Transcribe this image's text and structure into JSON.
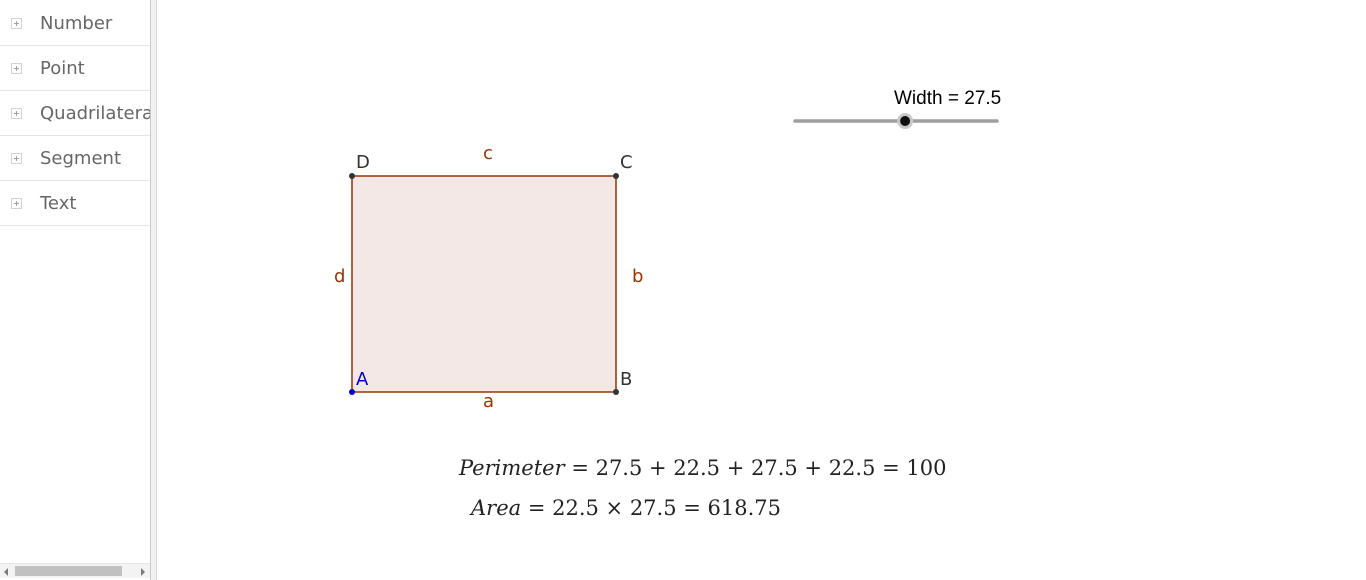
{
  "algebra": {
    "categories": [
      {
        "label": "Number"
      },
      {
        "label": "Point"
      },
      {
        "label": "Quadrilateral"
      },
      {
        "label": "Segment"
      },
      {
        "label": "Text"
      }
    ]
  },
  "graphics": {
    "vertices": {
      "A": "A",
      "B": "B",
      "C": "C",
      "D": "D"
    },
    "segments": {
      "a": "a",
      "b": "b",
      "c": "c",
      "d": "d"
    },
    "colors": {
      "polygon_fill": "#f3e8e6",
      "polygon_edge": "#993300",
      "point_free": "#0000cc",
      "point_dependent": "#333333"
    },
    "slider": {
      "name": "Width",
      "equals": "=",
      "value": "27.5",
      "fraction": 0.545
    },
    "perimeter": {
      "name": "Perimeter",
      "expression": "= 27.5 + 22.5 + 27.5 + 22.5 = 100"
    },
    "area": {
      "name": "Area",
      "expression": "= 22.5 × 27.5 = 618.75"
    }
  }
}
